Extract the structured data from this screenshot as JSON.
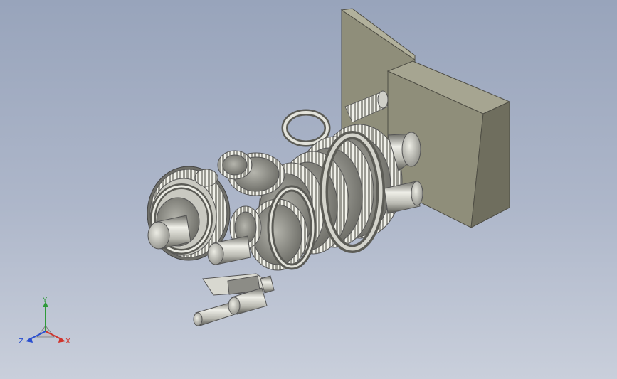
{
  "triad": {
    "x_label": "X",
    "y_label": "Y",
    "z_label": "Z",
    "x_color": "#d0342c",
    "y_color": "#2f9a3a",
    "z_color": "#2a4fd0"
  },
  "model": {
    "housing_face_color": "#8f8e7a",
    "housing_side_color": "#6f6e5e",
    "metal_light_color": "#d9d9d2",
    "metal_dark_color": "#5d5d58"
  }
}
